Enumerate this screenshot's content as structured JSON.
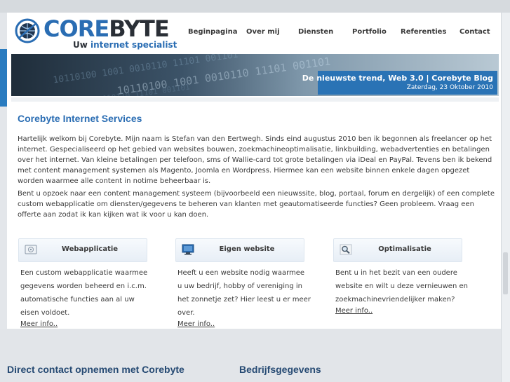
{
  "brand": {
    "name_part1": "CORE",
    "name_part2": "BYTE",
    "tagline_part1": "Uw ",
    "tagline_part2": "internet specialist"
  },
  "nav": {
    "items": [
      "Beginpagina",
      "Over mij",
      "Diensten",
      "Portfolio",
      "Referenties",
      "Contact"
    ]
  },
  "banner": {
    "title": "De nieuwste trend, Web 3.0 | Corebyte Blog",
    "date": "Zaterdag, 23 Oktober 2010",
    "bits_text": "10110100 1001 0010110 11101 001101"
  },
  "main": {
    "title": "Corebyte Internet Services",
    "paragraph1": "Hartelijk welkom bij Corebyte. Mijn naam is Stefan van den Eertwegh. Sinds eind augustus 2010 ben ik begonnen als freelancer op het internet. Gespecialiseerd op het gebied van websites bouwen, zoekmachineoptimalisatie, linkbuilding, webadvertenties en betalingen over het internet. Van kleine betalingen per telefoon, sms of Wallie-card tot grote betalingen via iDeal en PayPal. Tevens ben ik bekend met content management systemen als Magento, Joomla en Wordpress. Hiermee kan een website binnen enkele dagen opgezet worden waarmee alle content in notime beheerbaar is.",
    "paragraph2": "Bent u opzoek naar een content management systeem (bijvoorbeeld een nieuwssite, blog, portaal, forum en dergelijk) of een complete custom webapplicatie om diensten/gegevens te beheren van klanten met geautomatiseerde functies? Geen probleem. Vraag een offerte aan zodat ik kan kijken wat ik voor u kan doen."
  },
  "services": [
    {
      "title": "Webapplicatie",
      "icon": "webapp-icon",
      "text": "Een custom webapplicatie waarmee gegevens worden beheerd en i.c.m. automatische functies aan al uw eisen voldoet.",
      "more": "Meer info.."
    },
    {
      "title": "Eigen website",
      "icon": "monitor-icon",
      "text": "Heeft u een website nodig waarmee u uw bedrijf, hobby of vereniging in het zonnetje zet? Hier leest u er meer over.",
      "more": "Meer info.."
    },
    {
      "title": "Optimalisatie",
      "icon": "magnifier-icon",
      "text": "Bent u in het bezit van een oudere website en wilt u deze vernieuwen en zoekmachinevriendelijker maken?",
      "more": "Meer info.."
    }
  ],
  "footer": {
    "contact_heading": "Direct contact opnemen met Corebyte",
    "company_heading": "Bedrijfsgegevens"
  },
  "colors": {
    "brand_blue": "#2a6db3",
    "banner_box": "#2a73b5",
    "footer_heading": "#264a73"
  }
}
